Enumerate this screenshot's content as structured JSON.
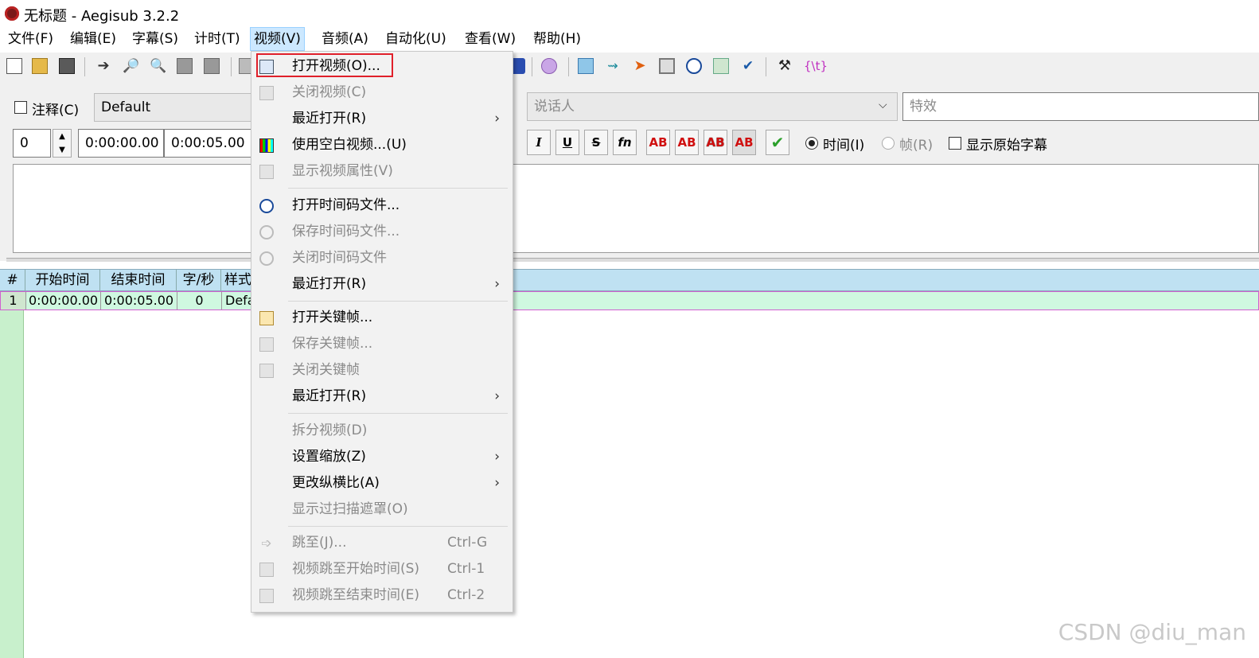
{
  "window": {
    "title": "无标题 - Aegisub 3.2.2"
  },
  "menubar": [
    "文件(F)",
    "编辑(E)",
    "字幕(S)",
    "计时(T)",
    "视频(V)",
    "音频(A)",
    "自动化(U)",
    "查看(W)",
    "帮助(H)"
  ],
  "editor": {
    "comment_label": "注释(C)",
    "style_value": "Default",
    "actor_placeholder": "说话人",
    "effect_placeholder": "特效",
    "layer_value": "0",
    "start_time": "0:00:00.00",
    "end_time": "0:00:05.00",
    "italic": "I",
    "underline": "U",
    "strike": "S",
    "fn": "fn",
    "color_buttons": [
      "AB",
      "AB",
      "AB",
      "AB"
    ],
    "time_radio": "时间(I)",
    "frame_radio": "帧(R)",
    "show_original": "显示原始字幕",
    "automation_button": "{\\t}"
  },
  "grid": {
    "headers": [
      "#",
      "开始时间",
      "结束时间",
      "字/秒",
      "样式"
    ],
    "row": [
      "1",
      "0:00:00.00",
      "0:00:05.00",
      "0",
      "Defa"
    ]
  },
  "dropdown": {
    "items": [
      {
        "label": "打开视频(O)...",
        "disabled": false,
        "submenu": false,
        "shortcut": ""
      },
      {
        "label": "关闭视频(C)",
        "disabled": true,
        "submenu": false,
        "shortcut": ""
      },
      {
        "label": "最近打开(R)",
        "disabled": false,
        "submenu": true,
        "shortcut": ""
      },
      {
        "label": "使用空白视频...(U)",
        "disabled": false,
        "submenu": false,
        "shortcut": ""
      },
      {
        "label": "显示视频属性(V)",
        "disabled": true,
        "submenu": false,
        "shortcut": ""
      },
      {
        "label": "打开时间码文件...",
        "disabled": false,
        "submenu": false,
        "shortcut": ""
      },
      {
        "label": "保存时间码文件...",
        "disabled": true,
        "submenu": false,
        "shortcut": ""
      },
      {
        "label": "关闭时间码文件",
        "disabled": true,
        "submenu": false,
        "shortcut": ""
      },
      {
        "label": "最近打开(R)",
        "disabled": false,
        "submenu": true,
        "shortcut": ""
      },
      {
        "label": "打开关键帧...",
        "disabled": false,
        "submenu": false,
        "shortcut": ""
      },
      {
        "label": "保存关键帧...",
        "disabled": true,
        "submenu": false,
        "shortcut": ""
      },
      {
        "label": "关闭关键帧",
        "disabled": true,
        "submenu": false,
        "shortcut": ""
      },
      {
        "label": "最近打开(R)",
        "disabled": false,
        "submenu": true,
        "shortcut": ""
      },
      {
        "label": "拆分视频(D)",
        "disabled": true,
        "submenu": false,
        "shortcut": ""
      },
      {
        "label": "设置缩放(Z)",
        "disabled": false,
        "submenu": true,
        "shortcut": ""
      },
      {
        "label": "更改纵横比(A)",
        "disabled": false,
        "submenu": true,
        "shortcut": ""
      },
      {
        "label": "显示过扫描遮罩(O)",
        "disabled": true,
        "submenu": false,
        "shortcut": ""
      },
      {
        "label": "跳至(J)...",
        "disabled": true,
        "submenu": false,
        "shortcut": "Ctrl-G"
      },
      {
        "label": "视频跳至开始时间(S)",
        "disabled": true,
        "submenu": false,
        "shortcut": "Ctrl-1"
      },
      {
        "label": "视频跳至结束时间(E)",
        "disabled": true,
        "submenu": false,
        "shortcut": "Ctrl-2"
      }
    ],
    "submenu_arrow": "›"
  },
  "watermark": "CSDN @diu_man",
  "colors": {
    "highlight": "#e0202a",
    "menu_active": "#cce8ff",
    "grid_header": "#bfe1f2",
    "grid_row": "#cff8e0"
  }
}
